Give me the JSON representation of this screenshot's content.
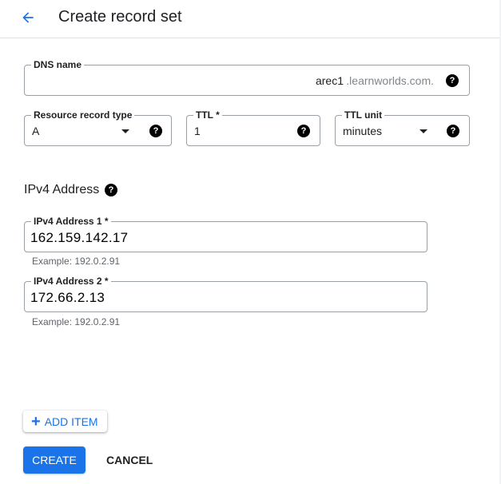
{
  "header": {
    "title": "Create record set",
    "back_icon": "arrow-left-icon"
  },
  "dns_name": {
    "label": "DNS name",
    "value": "arec1",
    "suffix": ".learnworlds.com."
  },
  "record_type": {
    "label": "Resource record type",
    "value": "A"
  },
  "ttl": {
    "label": "TTL *",
    "value": "1"
  },
  "ttl_unit": {
    "label": "TTL unit",
    "value": "minutes"
  },
  "help_glyph": "?",
  "ipv4": {
    "section_title": "IPv4 Address",
    "addresses": [
      {
        "label": "IPv4 Address 1 *",
        "value": "162.159.142.17",
        "hint": "Example: 192.0.2.91"
      },
      {
        "label": "IPv4 Address 2 *",
        "value": "172.66.2.13",
        "hint": "Example: 192.0.2.91"
      }
    ]
  },
  "actions": {
    "add_item": "ADD ITEM",
    "create": "CREATE",
    "cancel": "CANCEL"
  },
  "colors": {
    "accent": "#1a73e8",
    "text": "#202124",
    "muted": "#5f6368"
  }
}
